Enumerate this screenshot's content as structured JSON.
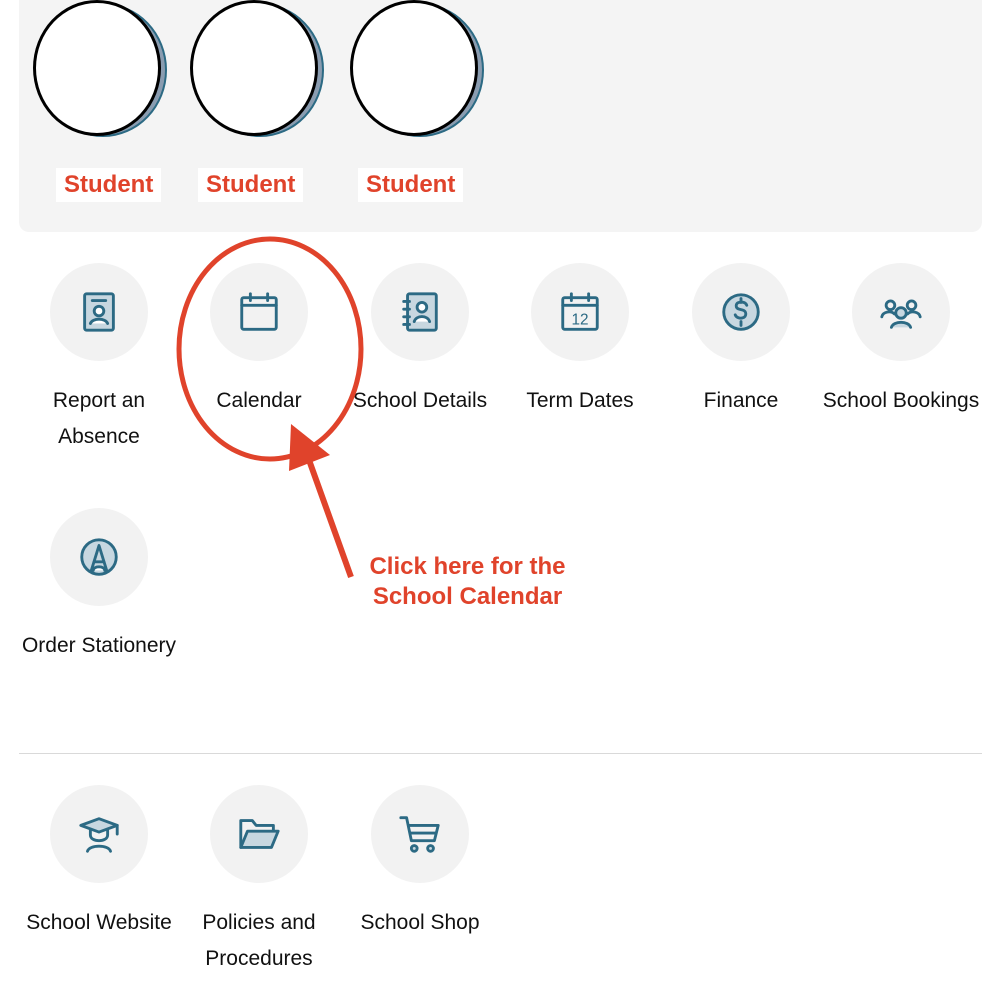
{
  "students": [
    {
      "label": "Student"
    },
    {
      "label": "Student"
    },
    {
      "label": "Student"
    }
  ],
  "tiles": [
    {
      "label": "Report an Absence",
      "icon": "report-absence-icon"
    },
    {
      "label": "Calendar",
      "icon": "calendar-icon"
    },
    {
      "label": "School Details",
      "icon": "contact-book-icon"
    },
    {
      "label": "Term Dates",
      "icon": "term-dates-calendar-icon",
      "icon_text": "12"
    },
    {
      "label": "Finance",
      "icon": "dollar-icon"
    },
    {
      "label": "School Bookings",
      "icon": "group-icon"
    },
    {
      "label": "Order Stationery",
      "icon": "stationery-icon"
    }
  ],
  "links": [
    {
      "label": "School Website",
      "icon": "graduate-icon"
    },
    {
      "label": "Policies and Procedures",
      "icon": "folder-icon"
    },
    {
      "label": "School Shop",
      "icon": "cart-icon"
    }
  ],
  "annotation": {
    "text_line1": "Click here for the",
    "text_line2": "School Calendar",
    "color": "#e0432b"
  },
  "colors": {
    "icon": "#2c6a84",
    "accent": "#e0432b",
    "panel": "#f4f4f4"
  }
}
